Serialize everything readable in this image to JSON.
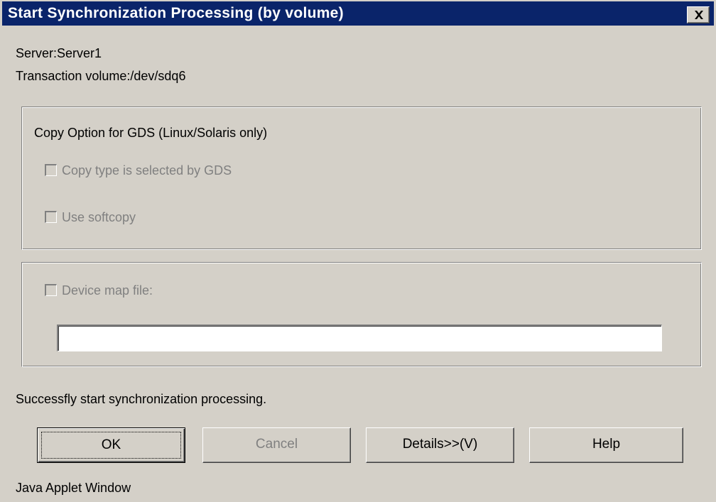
{
  "window": {
    "title": "Start Synchronization Processing (by volume)",
    "close_label": "Close"
  },
  "info": {
    "server": "Server:Server1",
    "transaction_volume": "Transaction volume:/dev/sdq6"
  },
  "copy_option_group": {
    "heading": "Copy Option for GDS (Linux/Solaris only)",
    "copy_type_label": "Copy type is selected by GDS",
    "copy_type_checked": false,
    "copy_type_enabled": false,
    "softcopy_label": "Use softcopy",
    "softcopy_checked": false,
    "softcopy_enabled": false
  },
  "device_map_group": {
    "label": "Device map file:",
    "checked": false,
    "enabled": false,
    "input_value": ""
  },
  "status": {
    "message": "Successfly start synchronization processing."
  },
  "buttons": {
    "ok": "OK",
    "cancel": "Cancel",
    "details": "Details>>(V)",
    "help": "Help"
  },
  "footer": {
    "applet_label": "Java Applet Window"
  },
  "colors": {
    "titlebar": "#0a246a",
    "face": "#d4d0c8",
    "disabled_text": "#808080"
  }
}
